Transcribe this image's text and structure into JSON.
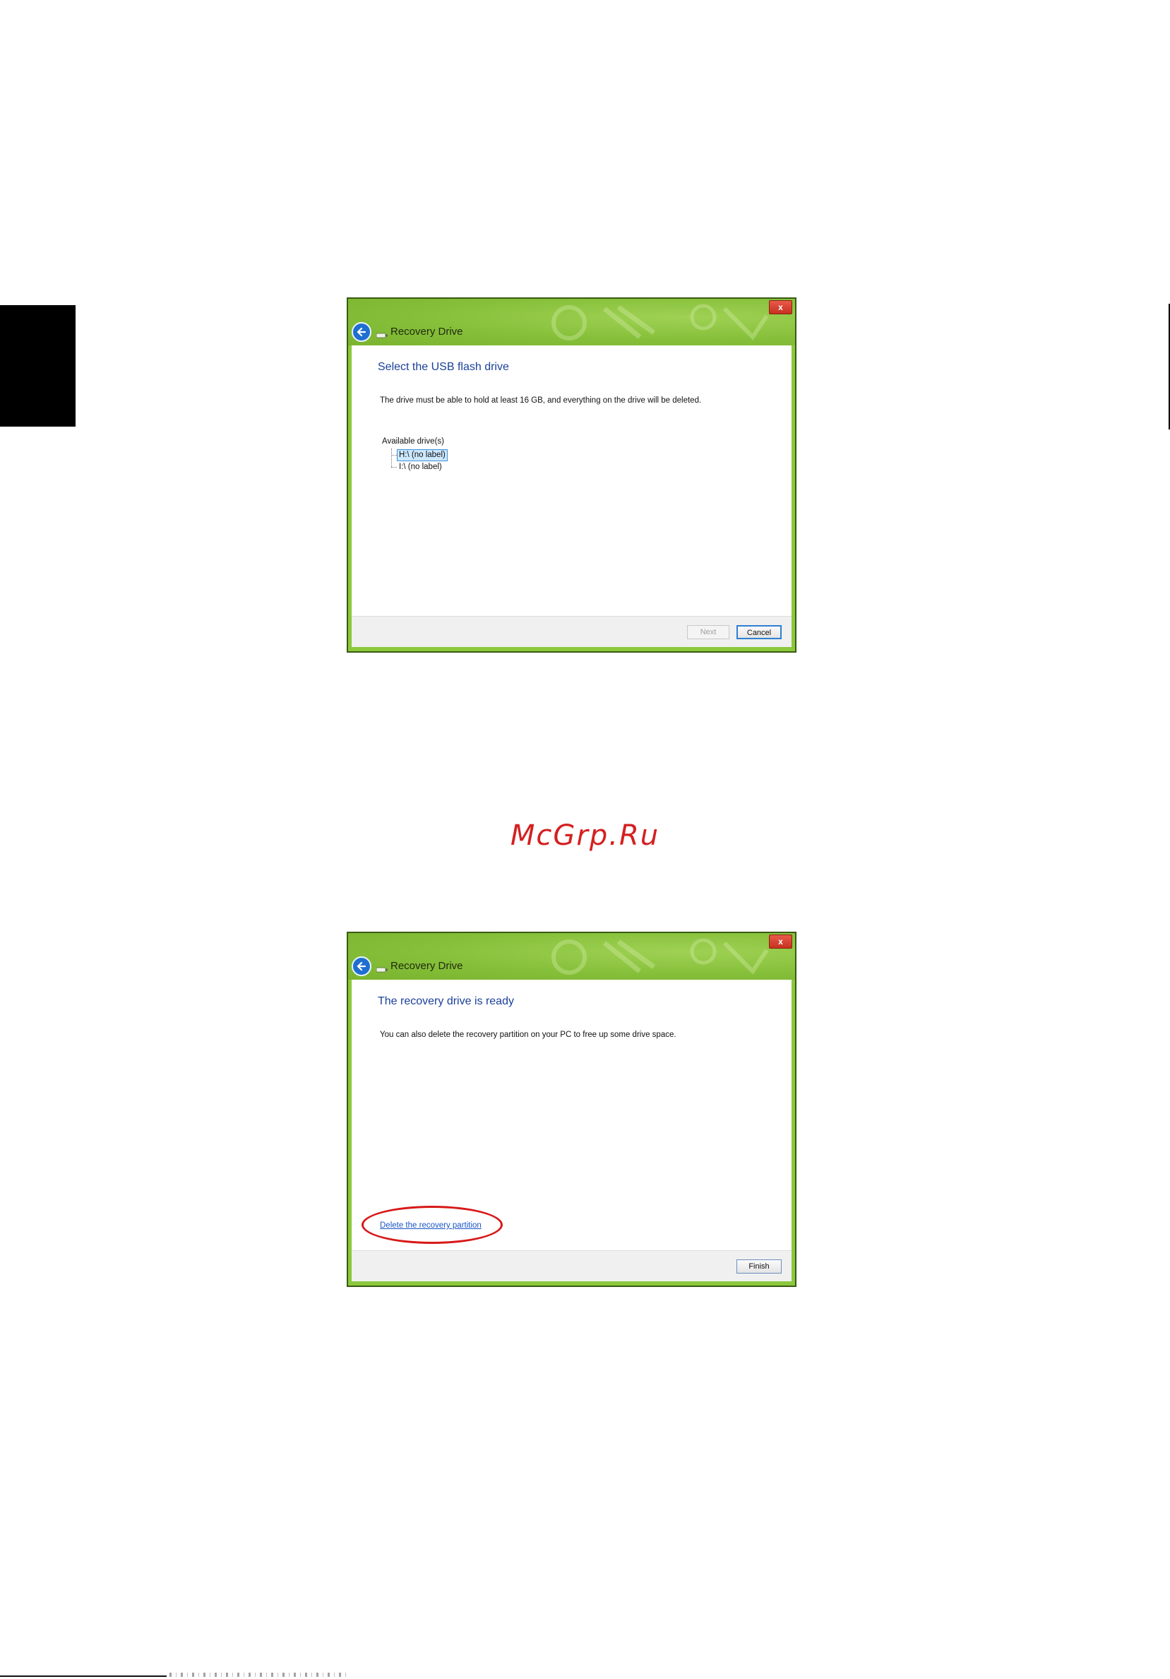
{
  "watermark": "McGrp.Ru",
  "dialog_one": {
    "window_title": "Recovery Drive",
    "close_label": "x",
    "heading": "Select the USB flash drive",
    "description": "The drive must be able to hold at least 16 GB, and everything on the drive will be deleted.",
    "drives_label": "Available drive(s)",
    "drives": [
      {
        "label": "H:\\ (no label)",
        "selected": true
      },
      {
        "label": "I:\\ (no label)",
        "selected": false
      }
    ],
    "next_label": "Next",
    "cancel_label": "Cancel"
  },
  "dialog_two": {
    "window_title": "Recovery Drive",
    "close_label": "x",
    "heading": "The recovery drive is ready",
    "description": "You can also delete the recovery partition on your PC to free up some drive space.",
    "delete_link": "Delete the recovery partition",
    "finish_label": "Finish"
  },
  "colors": {
    "titlebar_green": "#8cc83c",
    "heading_blue": "#1a3f9a",
    "highlight_red": "#d81818",
    "watermark_red": "#d42020"
  },
  "icons": [
    "back-arrow-icon",
    "usb-drive-icon",
    "close-icon"
  ]
}
